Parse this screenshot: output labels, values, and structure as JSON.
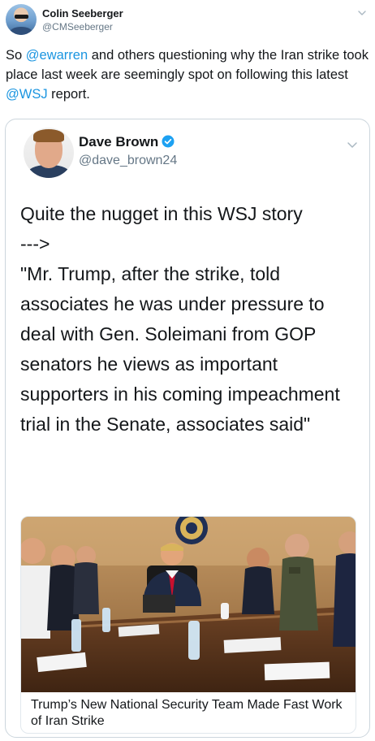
{
  "outer_tweet": {
    "name": "Colin Seeberger",
    "handle": "@CMSeeberger",
    "text_parts": {
      "p1": "So ",
      "m1": "@ewarren",
      "p2": " and others questioning why the Iran strike took place last week are seemingly spot on following this latest ",
      "m2": "@WSJ",
      "p3": " report."
    },
    "icon": "chevron-down-icon"
  },
  "quoted_tweet": {
    "name": "Dave Brown",
    "handle": "@dave_brown24",
    "verified": true,
    "text": "Quite the nugget in this WSJ story\n--->\n\"Mr. Trump, after the strike, told associates he was under pressure to deal with Gen. Soleimani from GOP senators he views as important supporters in his coming impeachment trial in the Senate, associates said\"",
    "link_card": {
      "title": "Trump’s New National Security Team Made Fast Work of Iran Strike",
      "image": "situation-room-photo"
    }
  },
  "colors": {
    "mention": "#1b95e0",
    "verified": "#1da1f2",
    "text": "#14171a",
    "secondary": "#657786",
    "border": "#ccd6dd"
  }
}
